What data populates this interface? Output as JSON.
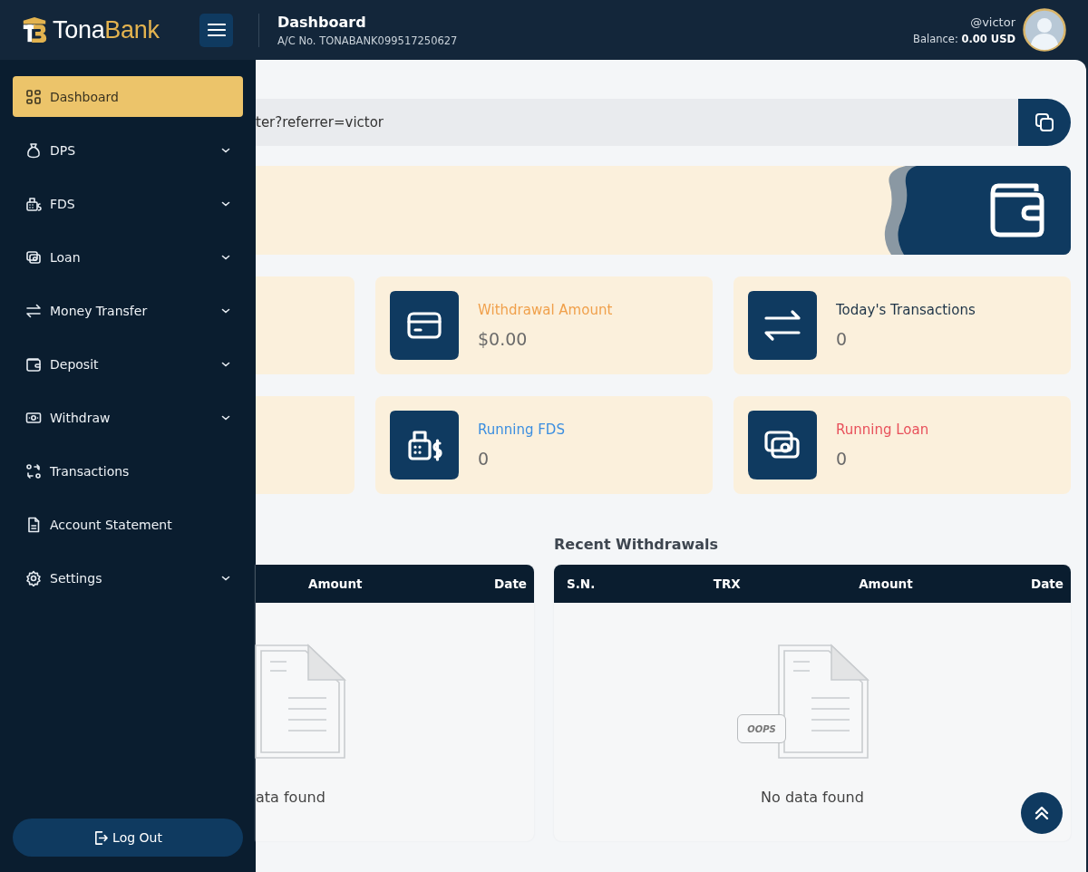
{
  "header": {
    "logo_part1": "Tona",
    "logo_part2": "Bank",
    "page_title": "Dashboard",
    "account_no": "A/C No. TONABANK099517250627",
    "username": "@victor",
    "balance_label": "Balance:",
    "balance_value": "0.00 USD"
  },
  "sidebar": {
    "items": [
      {
        "label": "Dashboard",
        "selected": true,
        "has_submenu": false
      },
      {
        "label": "DPS",
        "selected": false,
        "has_submenu": true
      },
      {
        "label": "FDS",
        "selected": false,
        "has_submenu": true
      },
      {
        "label": "Loan",
        "selected": false,
        "has_submenu": true
      },
      {
        "label": "Money Transfer",
        "selected": false,
        "has_submenu": true
      },
      {
        "label": "Deposit",
        "selected": false,
        "has_submenu": true
      },
      {
        "label": "Withdraw",
        "selected": false,
        "has_submenu": true
      },
      {
        "label": "Transactions",
        "selected": false,
        "has_submenu": false
      },
      {
        "label": "Account Statement",
        "selected": false,
        "has_submenu": false
      },
      {
        "label": "Settings",
        "selected": false,
        "has_submenu": true
      }
    ],
    "logout": "Log Out"
  },
  "referral": {
    "value": "ter?referrer=victor"
  },
  "stats": [
    {
      "title": "Withdrawal Amount",
      "value": "$0.00",
      "color": "#f0a04b"
    },
    {
      "title": "Today's Transactions",
      "value": "0",
      "color": "#1d3347"
    },
    {
      "title": "Running FDS",
      "value": "0",
      "color": "#3b8ee0"
    },
    {
      "title": "Running Loan",
      "value": "0",
      "color": "#e8505b"
    }
  ],
  "tables": [
    {
      "columns": [
        "Amount",
        "Date"
      ],
      "empty_text": "ata found"
    },
    {
      "title": "Recent Withdrawals",
      "columns": [
        "S.N.",
        "TRX",
        "Amount",
        "Date"
      ],
      "empty_text": "No data found",
      "oops_label": "OOPS"
    }
  ]
}
